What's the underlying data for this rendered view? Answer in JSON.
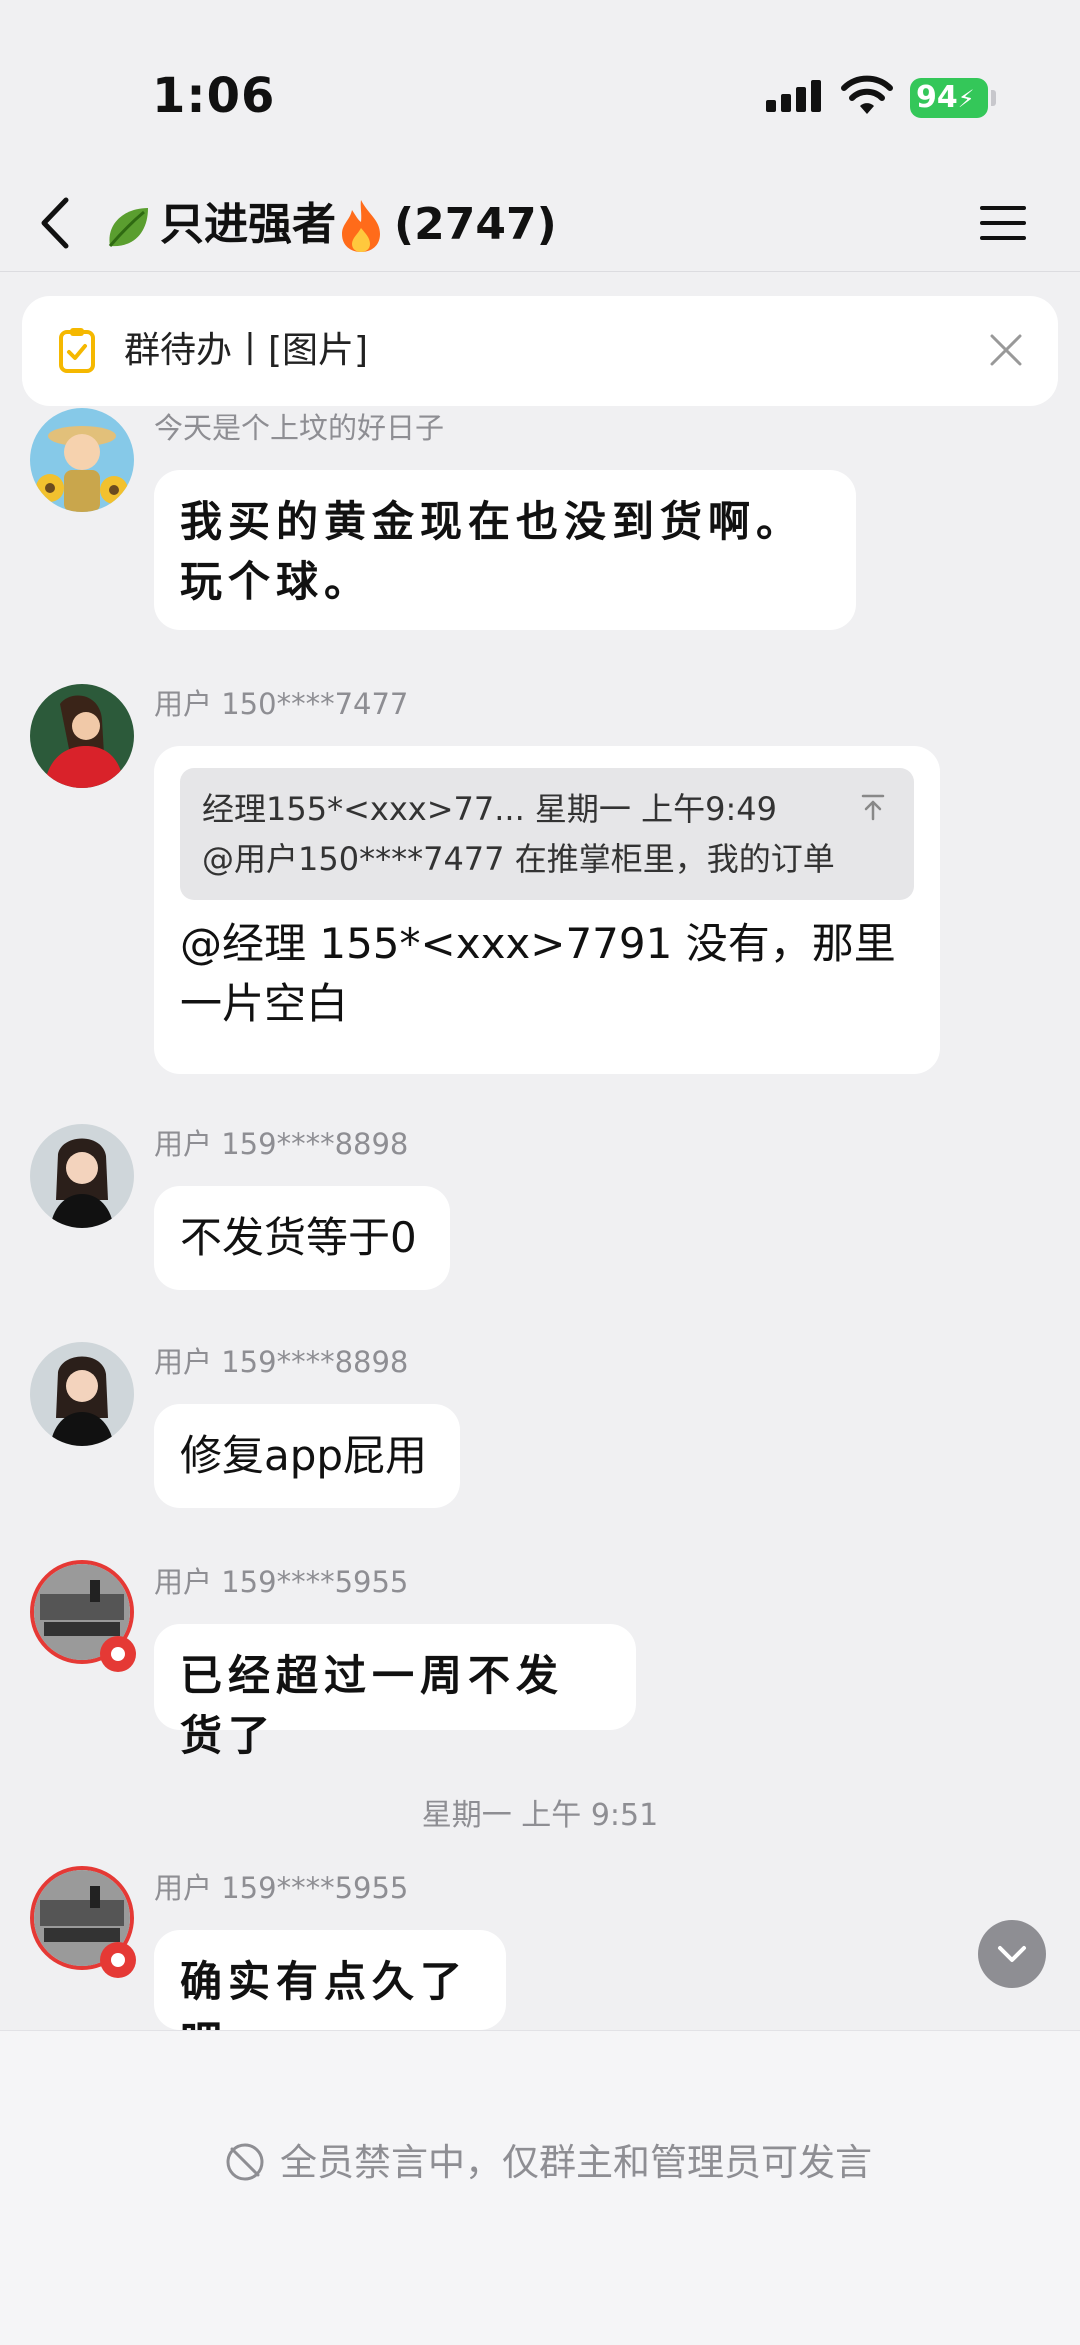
{
  "status_bar": {
    "time": "1:06",
    "battery": "94"
  },
  "nav": {
    "title": "只进强者",
    "member_count": "(2747)"
  },
  "todo_banner": {
    "text": "群待办丨[图片]"
  },
  "messages": [
    {
      "sender": "今天是个上坟的好日子",
      "text": "我买的黄金现在也没到货啊。玩个球。"
    },
    {
      "sender": "用户 150****7477",
      "quote_line1": "经理155*<xxx>77... 星期一 上午9:49",
      "quote_line2": "@用户150****7477 在推掌柜里，我的订单",
      "text": "@经理 155*<xxx>7791 没有，那里一片空白"
    },
    {
      "sender": "用户 159****8898",
      "text": "不发货等于0"
    },
    {
      "sender": "用户 159****8898",
      "text": "修复app屁用"
    },
    {
      "sender": "用户 159****5955",
      "text": "已经超过一周不发货了"
    },
    {
      "sender": "用户 159****5955",
      "text": "确实有点久了吧"
    }
  ],
  "time_divider": "星期一 上午 9:51",
  "bottom_bar": {
    "mute_notice": "全员禁言中，仅群主和管理员可发言"
  },
  "icons": [
    "signal-icon",
    "wifi-icon",
    "battery-icon",
    "back-icon",
    "leaf-icon",
    "fire-icon",
    "menu-icon",
    "todo-icon",
    "close-icon",
    "pin-top-icon",
    "scroll-down-icon",
    "mute-icon"
  ],
  "colors": {
    "background": "#f0f0f2",
    "bubble": "#ffffff",
    "battery": "#34c759",
    "secondary_text": "#8e8e93",
    "avatar_badge": "#e53935"
  }
}
